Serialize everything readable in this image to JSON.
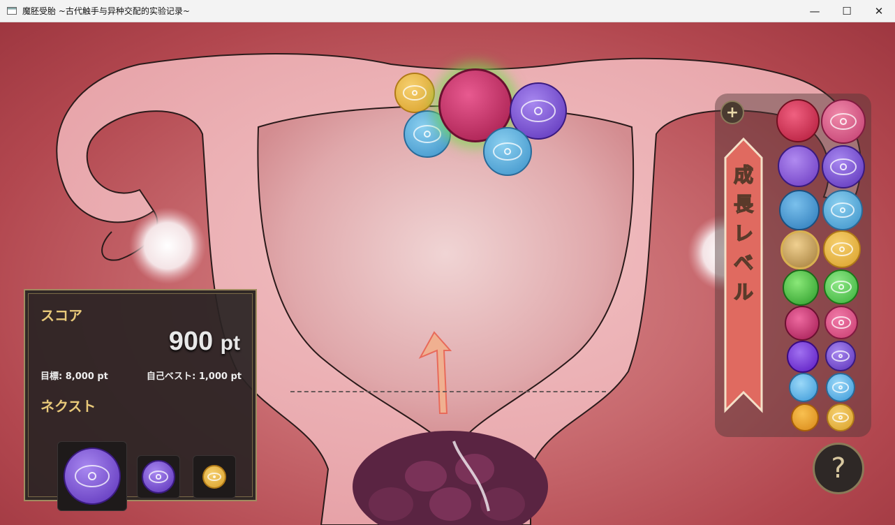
{
  "window": {
    "title": "魔胚受胎 ~古代触手与异种交配的实验记录~",
    "min_glyph": "—",
    "max_glyph": "☐",
    "close_glyph": "✕"
  },
  "score_panel": {
    "score_label": "スコア",
    "score_value": "900",
    "score_unit": "pt",
    "goal_text": "目標: 8,000 pt",
    "best_text": "自己ベスト: 1,000 pt",
    "next_label": "ネクスト"
  },
  "growth_panel": {
    "plus_glyph": "+",
    "ribbon_chars": [
      "成",
      "長",
      "レ",
      "ベ",
      "ル"
    ]
  },
  "help_button": {
    "glyph": "?"
  },
  "colors": {
    "gold": "#e8c97a",
    "pink": "#c83a6e",
    "purple": "#7b4fd0",
    "blue": "#4aa6d8",
    "yellow": "#e6b23c",
    "green": "#4cc44a",
    "dark_red": "#c22a4a"
  }
}
